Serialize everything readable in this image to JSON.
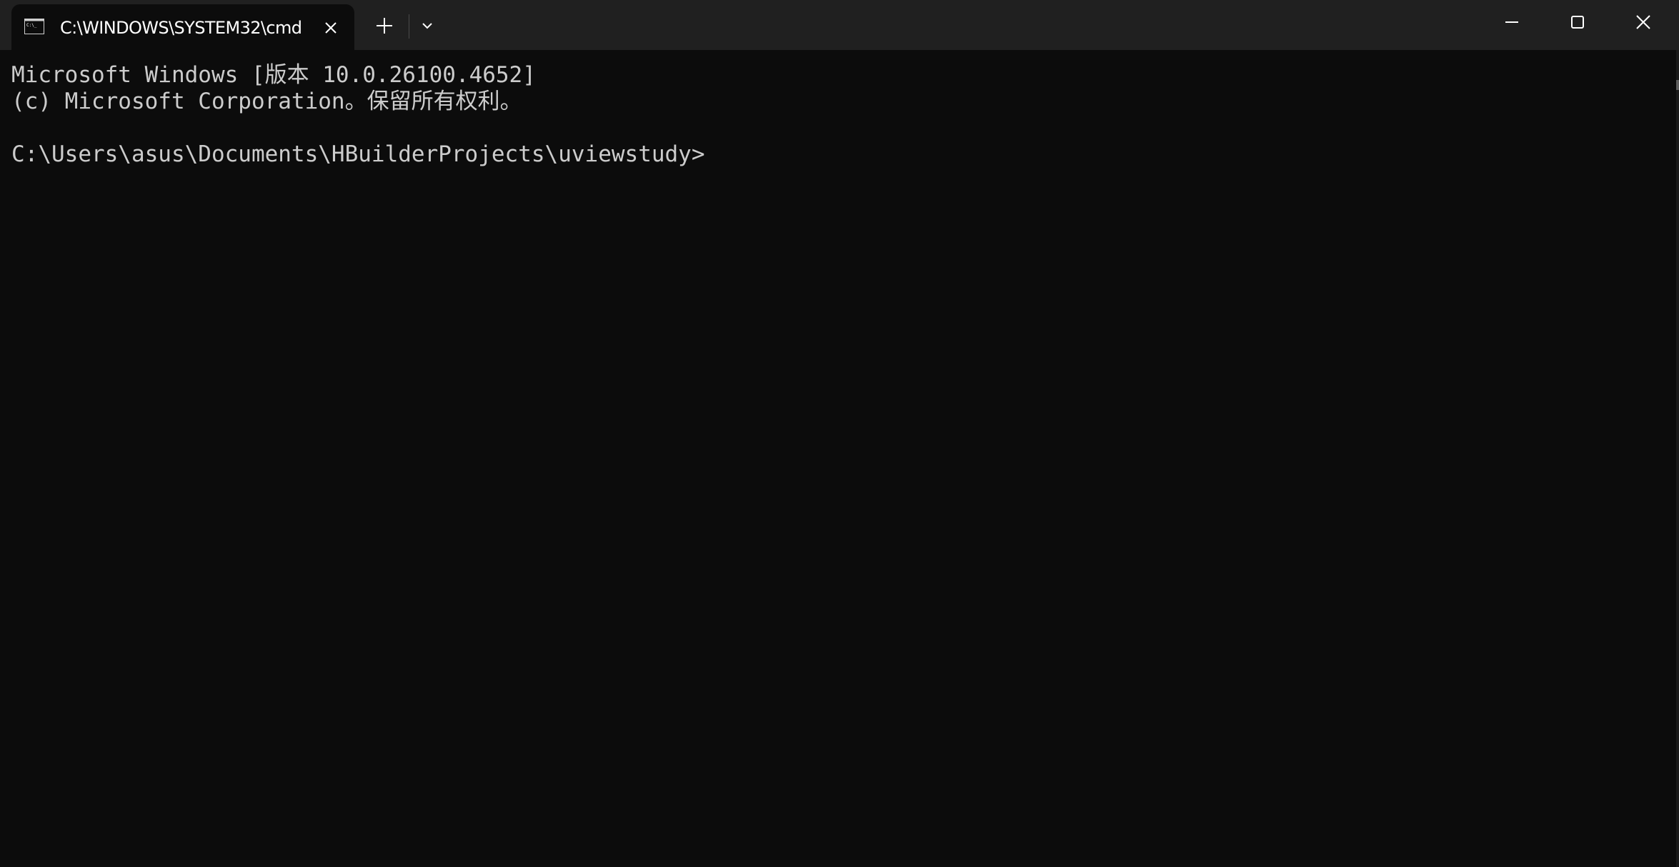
{
  "window": {
    "tab_title": "C:\\WINDOWS\\SYSTEM32\\cmd",
    "tab_icon": "console-icon",
    "new_tab_icon": "plus-icon",
    "dropdown_icon": "chevron-down-icon",
    "controls": [
      "minimize-icon",
      "maximize-icon",
      "close-icon"
    ]
  },
  "terminal": {
    "lines": [
      "Microsoft Windows [版本 10.0.26100.4652]",
      "(c) Microsoft Corporation。保留所有权利。",
      "C:\\Users\\asus\\Documents\\HBuilderProjects\\uviewstudy>"
    ]
  },
  "colors": {
    "titlebar_bg": "#202020",
    "terminal_bg": "#0c0c0c",
    "terminal_fg": "#cccccc",
    "tab_title_fg": "#ffffff"
  }
}
